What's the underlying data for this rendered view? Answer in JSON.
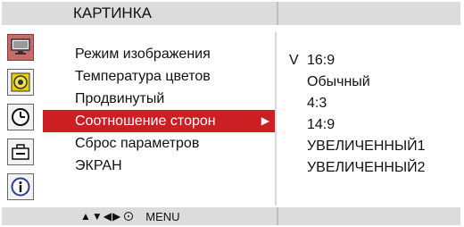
{
  "header": {
    "title": "КАРТИНКА"
  },
  "icons": [
    {
      "name": "monitor-icon",
      "selected": true
    },
    {
      "name": "speaker-icon",
      "selected": false
    },
    {
      "name": "clock-icon",
      "selected": false
    },
    {
      "name": "toolbox-icon",
      "selected": false
    },
    {
      "name": "info-icon",
      "selected": false
    }
  ],
  "menu": {
    "items": [
      {
        "label": "Режим изображения"
      },
      {
        "label": "Температура цветов"
      },
      {
        "label": "Продвинутый"
      },
      {
        "label": "Соотношение сторон",
        "selected": true
      },
      {
        "label": "Сброс параметров"
      },
      {
        "label": "ЭКРАН"
      }
    ],
    "selected_arrow": "▶"
  },
  "options": {
    "check_mark": "V",
    "items": [
      {
        "label": "16:9",
        "checked": true
      },
      {
        "label": "Обычный"
      },
      {
        "label": "4:3"
      },
      {
        "label": "14:9"
      },
      {
        "label": "УВЕЛИЧЕННЫЙ1"
      },
      {
        "label": "УВЕЛИЧЕННЫЙ2"
      }
    ]
  },
  "footer": {
    "keys": [
      "▲",
      "▼",
      "◀",
      "▶"
    ],
    "menu_label": "MENU"
  },
  "colors": {
    "selection_red": "#cc1f24",
    "bar_gray": "#dcdcdc",
    "icon_selected": "#c66a6a"
  }
}
